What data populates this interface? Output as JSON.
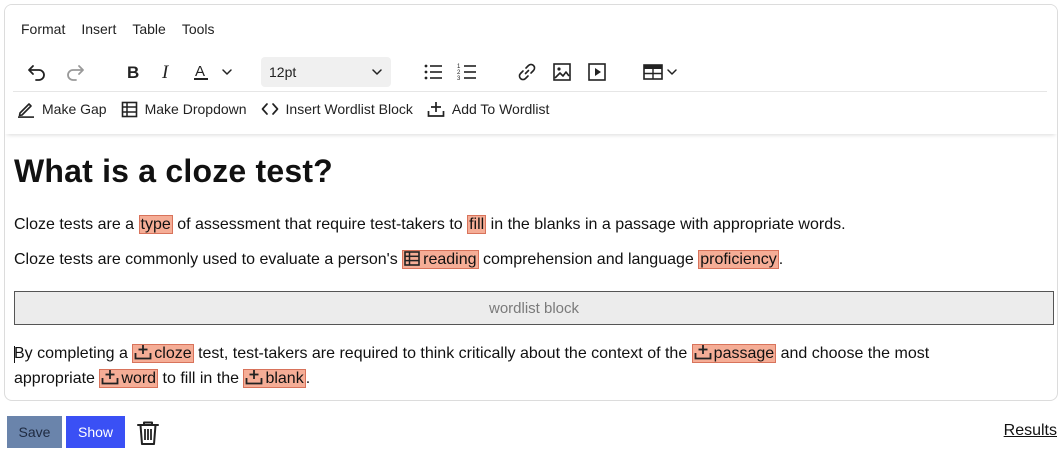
{
  "menu": {
    "items": [
      "Format",
      "Insert",
      "Table",
      "Tools"
    ]
  },
  "toolbar": {
    "font_size": "12pt",
    "icons": [
      "undo-icon",
      "redo-icon",
      "bold-icon",
      "italic-icon",
      "text-color-icon",
      "bullet-list-icon",
      "numbered-list-icon",
      "link-icon",
      "image-icon",
      "media-icon",
      "table-icon"
    ]
  },
  "toolbar2": {
    "make_gap": "Make Gap",
    "make_dropdown": "Make Dropdown",
    "insert_wordlist_block": "Insert Wordlist Block",
    "add_to_wordlist": "Add To Wordlist"
  },
  "content": {
    "heading": "What is a cloze test?",
    "p1": {
      "t1": "Cloze tests are a ",
      "g1": "type",
      "t2": " of assessment that require test-takers to ",
      "g2": "fill",
      "t3": " in the blanks in a passage with appropriate words."
    },
    "p2": {
      "t1": "Cloze tests are commonly used to evaluate a person's ",
      "g1": "reading",
      "t2": " comprehension and language ",
      "g2": "proficiency",
      "t3": "."
    },
    "wordlist_block": "wordlist block",
    "p3": {
      "t1": "By completing a ",
      "g1": "cloze",
      "t2": " test, test-takers are required to think critically about the context of the ",
      "g2": "passage",
      "t3": " and choose the most appropriate ",
      "g3": "word",
      "t4": " to fill in the ",
      "g4": "blank",
      "t5": "."
    }
  },
  "actions": {
    "save": "Save",
    "show": "Show",
    "results": "Results"
  },
  "colors": {
    "gap_fill": "#f5ad96",
    "gap_border": "#d8735b",
    "save_bg": "#6a84ab",
    "show_bg": "#3a50f5"
  }
}
